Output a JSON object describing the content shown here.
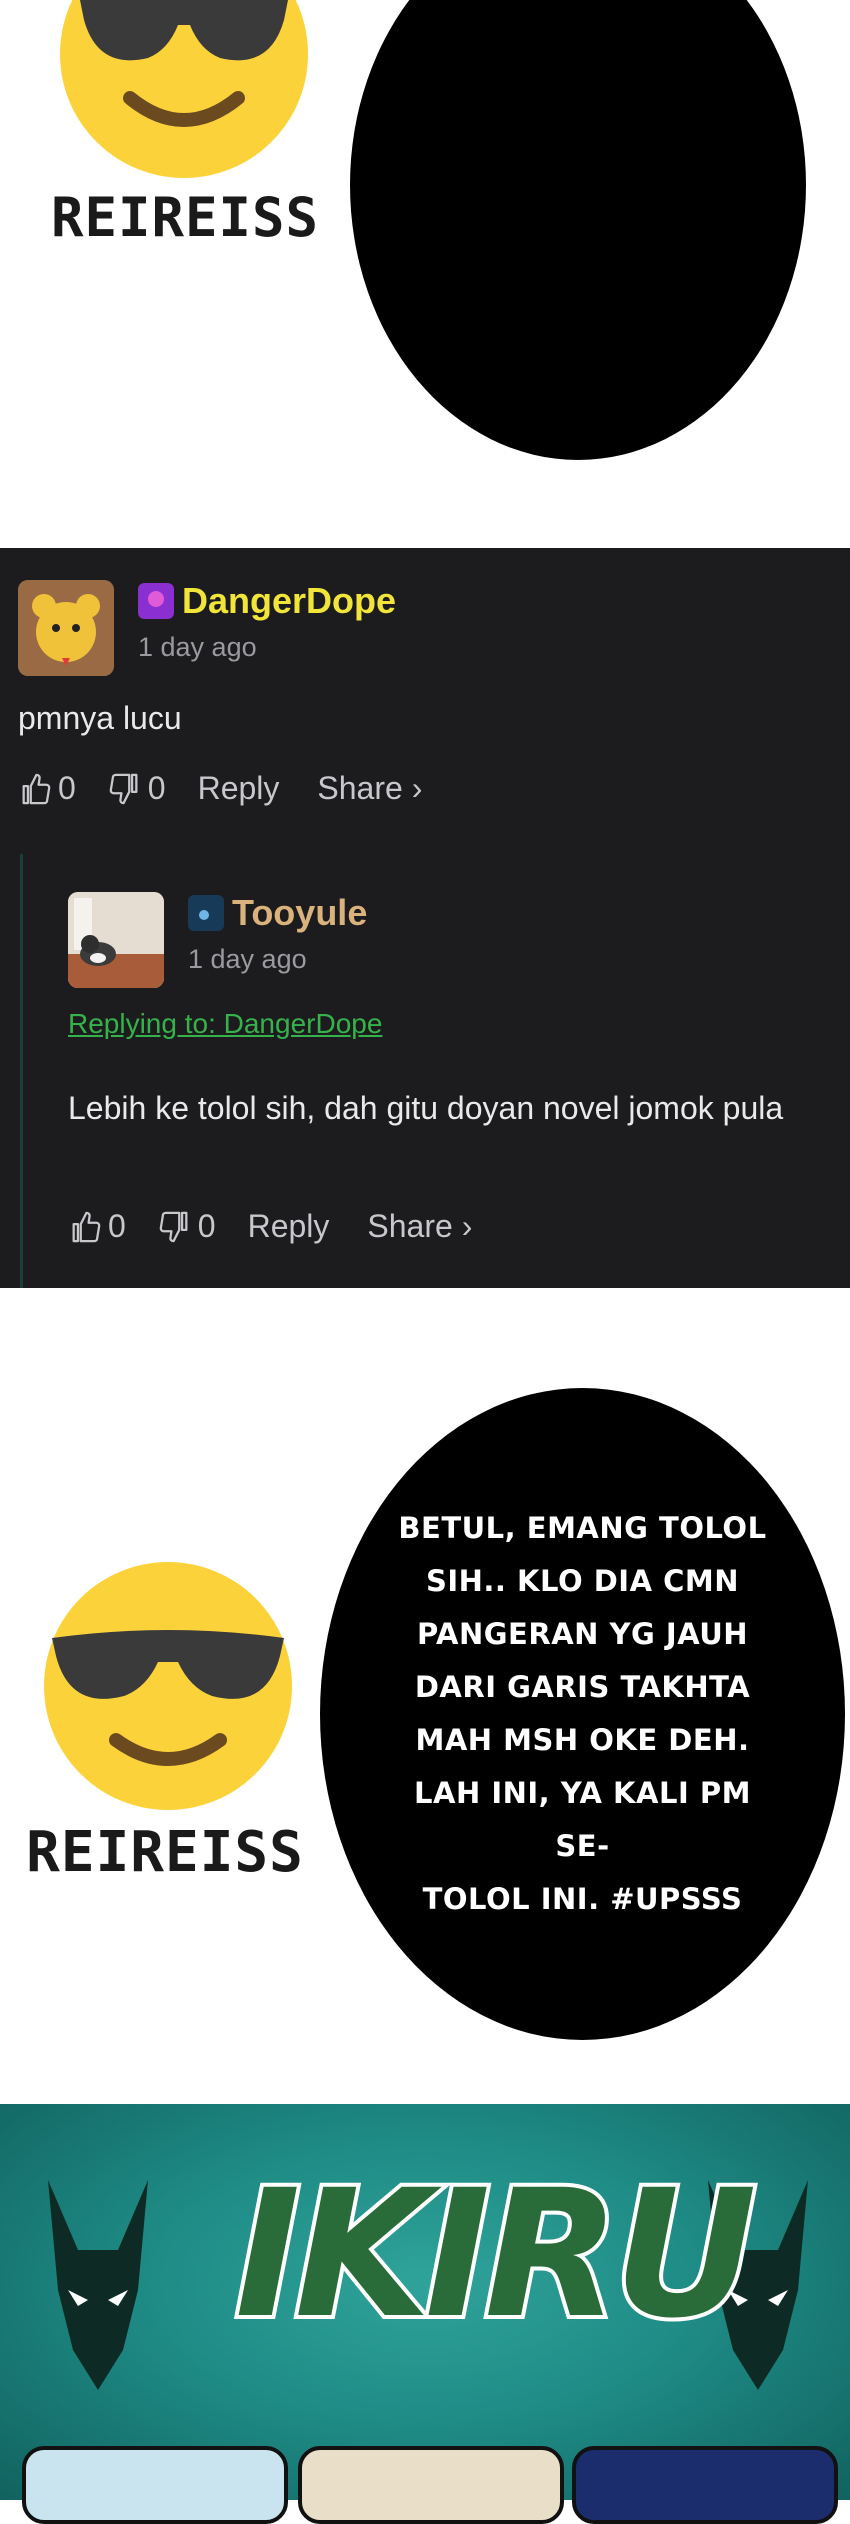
{
  "panel_top": {
    "emoji_label": "REIREISS"
  },
  "comments": [
    {
      "username": "DangerDope",
      "username_color": "#f2e53a",
      "time": "1 day ago",
      "text": "pmnya lucu",
      "likes": "0",
      "dislikes": "0",
      "reply_label": "Reply",
      "share_label": "Share ›",
      "replies": [
        {
          "username": "Tooyule",
          "username_color": "#d9b27c",
          "time": "1 day ago",
          "replying_to": "Replying to: DangerDope",
          "text": "Lebih ke tolol sih, dah gitu doyan novel jomok pula",
          "likes": "0",
          "dislikes": "0",
          "reply_label": "Reply",
          "share_label": "Share ›"
        }
      ]
    }
  ],
  "panel_middle": {
    "emoji_label": "REIREISS",
    "bubble_lines": [
      "BETUL, EMANG TOLOL",
      "SIH.. KLO DIA CMN",
      "PANGERAN YG JAUH",
      "DARI GARIS TAKHTA",
      "MAH MSH OKE DEH.",
      "LAH INI, YA KALI PM SE-",
      "TOLOL INI. #UPSSS"
    ]
  },
  "banner": {
    "logo_text": "IKIRU",
    "accent": "#1f8c86"
  }
}
